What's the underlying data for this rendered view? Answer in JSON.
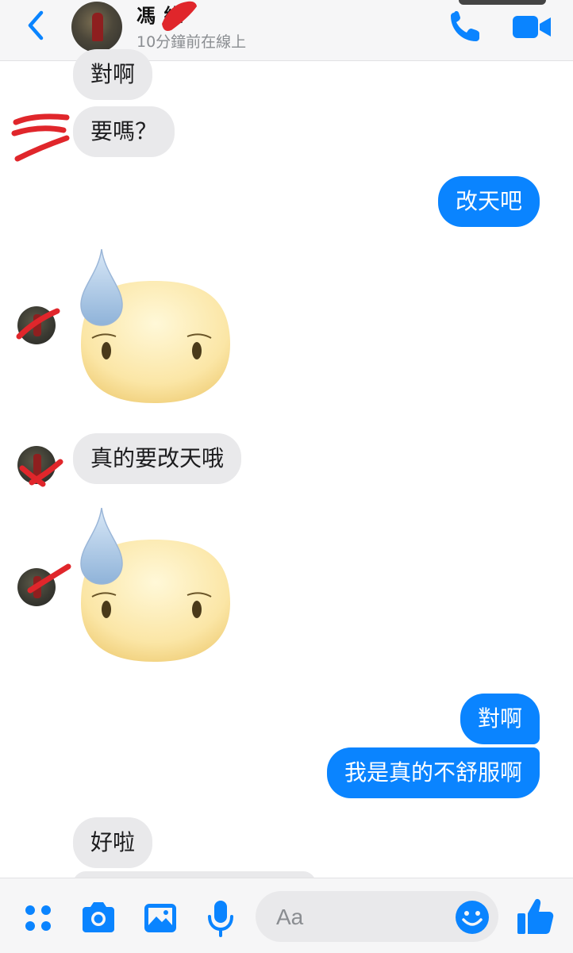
{
  "header": {
    "contact_name": "馮  維",
    "status": "10分鐘前在線上",
    "back_icon": "chevron-left-icon",
    "call_icon": "phone-icon",
    "video_icon": "video-camera-icon"
  },
  "messages": [
    {
      "side": "left",
      "text": "對啊"
    },
    {
      "side": "left",
      "text": "要嗎？"
    },
    {
      "side": "right",
      "text": "改天吧"
    },
    {
      "side": "left",
      "sticker": "sweat-face-sticker"
    },
    {
      "side": "left",
      "text": "真的要改天哦"
    },
    {
      "side": "left",
      "sticker": "sweat-face-sticker"
    },
    {
      "side": "right",
      "text": "對啊"
    },
    {
      "side": "right",
      "text": "我是真的不舒服啊"
    },
    {
      "side": "left",
      "text": "好啦"
    }
  ],
  "composer": {
    "placeholder": "Aa",
    "icons": [
      "menu-dots-icon",
      "camera-icon",
      "image-icon",
      "microphone-icon",
      "emoji-icon",
      "thumbs-up-icon"
    ]
  },
  "colors": {
    "accent": "#0a84ff",
    "incoming_bubble": "#e9e9eb",
    "redaction": "#e0262b"
  }
}
